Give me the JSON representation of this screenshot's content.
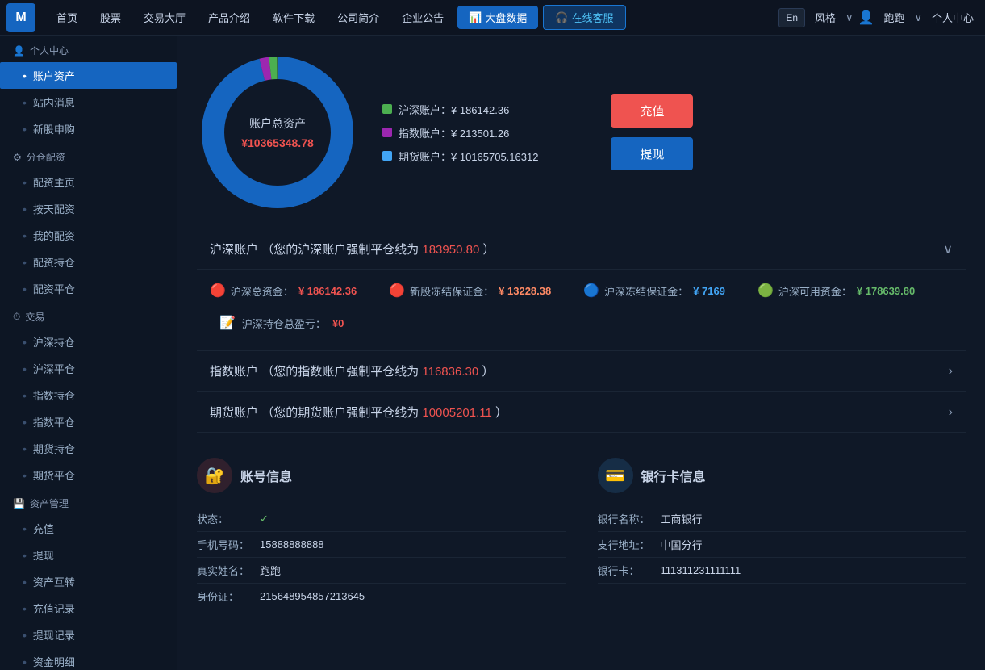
{
  "topnav": {
    "logo": "M",
    "links": [
      "首页",
      "股票",
      "交易大厅",
      "产品介绍",
      "软件下载",
      "公司简介",
      "企业公告"
    ],
    "market_btn": "大盘数据",
    "service_btn": "在线客服",
    "lang": "En",
    "style_label": "风格",
    "user_label": "跑跑",
    "personal_center": "个人中心"
  },
  "sidebar": {
    "section1": "个人中心",
    "items1": [
      "账户资产",
      "站内消息",
      "新股申购"
    ],
    "section2": "分仓配资",
    "items2": [
      "配资主页",
      "按天配资",
      "我的配资",
      "配资持仓",
      "配资平仓"
    ],
    "section3": "交易",
    "items3": [
      "沪深持仓",
      "沪深平仓",
      "指数持仓",
      "指数平仓",
      "期货持仓",
      "期货平仓"
    ],
    "section4": "资产管理",
    "items4": [
      "充值",
      "提现",
      "资产互转",
      "充值记录",
      "提现记录",
      "资金明细"
    ]
  },
  "asset": {
    "title": "账户总资产",
    "total_value": "¥10365348.78",
    "legend": [
      {
        "label": "沪深账户：¥ 186142.36",
        "color": "#4caf50"
      },
      {
        "label": "指数账户：¥ 213501.26",
        "color": "#9c27b0"
      },
      {
        "label": "期货账户：¥ 10165705.16312",
        "color": "#42a5f5"
      }
    ],
    "recharge_btn": "充值",
    "withdraw_btn": "提现"
  },
  "husheng_account": {
    "title": "沪深账户",
    "subtitle": "（您的沪深账户强制平仓线为",
    "force_line": "183950.80",
    "suffix": "）",
    "stats": [
      {
        "icon": "🔴",
        "label": "沪深总资金：",
        "value": "¥ 186142.36",
        "color": "red"
      },
      {
        "icon": "🔴",
        "label": "新股冻结保证金：",
        "value": "¥ 13228.38",
        "color": "orange"
      },
      {
        "icon": "🔵",
        "label": "沪深冻结保证金：",
        "value": "¥ 7169",
        "color": "blue"
      },
      {
        "icon": "🟢",
        "label": "沪深可用资金：",
        "value": "¥ 178639.80",
        "color": "green"
      }
    ],
    "profit_label": "沪深持仓总盈亏：",
    "profit_value": "¥0"
  },
  "index_account": {
    "title": "指数账户",
    "subtitle": "（您的指数账户强制平仓线为",
    "force_line": "116836.30",
    "suffix": "）"
  },
  "futures_account": {
    "title": "期货账户",
    "subtitle": "（您的期货账户强制平仓线为",
    "force_line": "10005201.11",
    "suffix": "）"
  },
  "account_info": {
    "title": "账号信息",
    "rows": [
      {
        "label": "状态：",
        "value": "✓",
        "is_check": true
      },
      {
        "label": "手机号码：",
        "value": "15888888888"
      },
      {
        "label": "真实姓名：",
        "value": "跑跑"
      },
      {
        "label": "身份证：",
        "value": "215648954857213645"
      }
    ]
  },
  "bank_info": {
    "title": "银行卡信息",
    "rows": [
      {
        "label": "银行名称：",
        "value": "工商银行"
      },
      {
        "label": "支行地址：",
        "value": "中国分行"
      },
      {
        "label": "银行卡：",
        "value": "111311231111111"
      }
    ]
  },
  "donut": {
    "segments": [
      {
        "value": 186142.36,
        "color": "#4caf50"
      },
      {
        "value": 213501.26,
        "color": "#9c27b0"
      },
      {
        "value": 10165705.16,
        "color": "#1565c0"
      }
    ]
  }
}
